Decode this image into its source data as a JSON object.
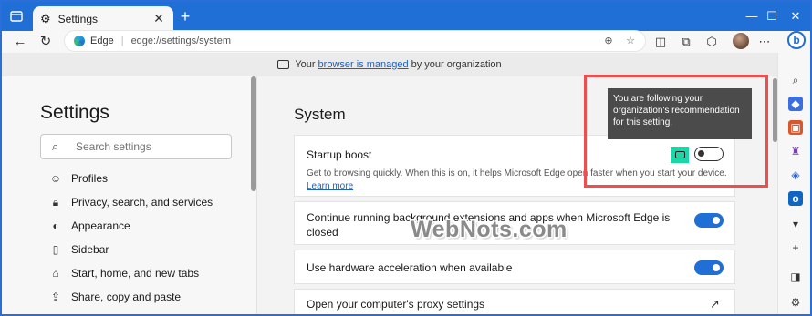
{
  "browser": {
    "tab_title": "Settings",
    "tab_close": "✕",
    "new_tab": "+",
    "window_controls": {
      "minimize": "—",
      "maximize": "☐",
      "close": "✕"
    },
    "site_label": "Edge",
    "url": "edge://settings/system"
  },
  "banner": {
    "prefix": "Your",
    "link": "browser is managed",
    "suffix": "by your organization"
  },
  "sidebar": {
    "title": "Settings",
    "search_placeholder": "Search settings",
    "items": [
      {
        "label": "Profiles",
        "icon": "person-icon"
      },
      {
        "label": "Privacy, search, and services",
        "icon": "lock-icon"
      },
      {
        "label": "Appearance",
        "icon": "palette-icon"
      },
      {
        "label": "Sidebar",
        "icon": "sidebar-icon"
      },
      {
        "label": "Start, home, and new tabs",
        "icon": "home-icon"
      },
      {
        "label": "Share, copy and paste",
        "icon": "share-icon"
      }
    ]
  },
  "main": {
    "page_title": "System",
    "startup_boost": {
      "title": "Startup boost",
      "description": "Get to browsing quickly. When this is on, it helps Microsoft Edge open faster when you start your device.",
      "learn_more": "Learn more",
      "enabled": false
    },
    "continue_running": {
      "title_line1": "Continue running background extensions and apps when Microsoft Edge is",
      "title_line2": "closed",
      "enabled": true
    },
    "hardware_acceleration": {
      "title": "Use hardware acceleration when available",
      "enabled": true
    },
    "proxy": {
      "title": "Open your computer's proxy settings"
    }
  },
  "tooltip": {
    "text_line1": "You are following your",
    "text_line2": "organization's recommendation",
    "text_line3": "for this setting."
  },
  "watermark": "WebNots.com",
  "colors": {
    "accent": "#1f6fd6",
    "policy_badge": "#19d8a8",
    "highlight_box": "#f04e4e",
    "tooltip_bg": "#4b4b4b"
  }
}
